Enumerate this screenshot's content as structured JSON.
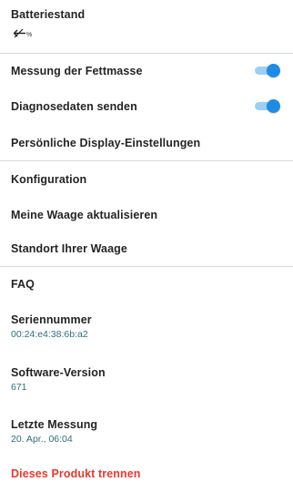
{
  "settings": {
    "battery": {
      "title": "Batteriestand",
      "unit": "%"
    },
    "fat_mass": {
      "title": "Messung der Fettmasse",
      "enabled": true
    },
    "diagnostics": {
      "title": "Diagnosedaten senden",
      "enabled": true
    },
    "display_settings": {
      "title": "Persönliche Display-Einstellungen"
    },
    "configuration": {
      "title": "Konfiguration"
    },
    "update_scale": {
      "title": "Meine Waage aktualisieren"
    },
    "location": {
      "title": "Standort Ihrer Waage"
    },
    "faq": {
      "title": "FAQ"
    },
    "serial": {
      "title": "Seriennummer",
      "value": "00:24:e4:38:6b:a2"
    },
    "software": {
      "title": "Software-Version",
      "value": "671"
    },
    "last_measurement": {
      "title": "Letzte Messung",
      "value": "20. Apr., 06:04"
    },
    "disconnect": {
      "label": "Dieses Produkt trennen"
    }
  },
  "colors": {
    "accent": "#1e8ce6",
    "accent_track": "#9dcff3",
    "value_text": "#2e6f79",
    "danger": "#e8392f",
    "divider": "#d8d8d8"
  }
}
